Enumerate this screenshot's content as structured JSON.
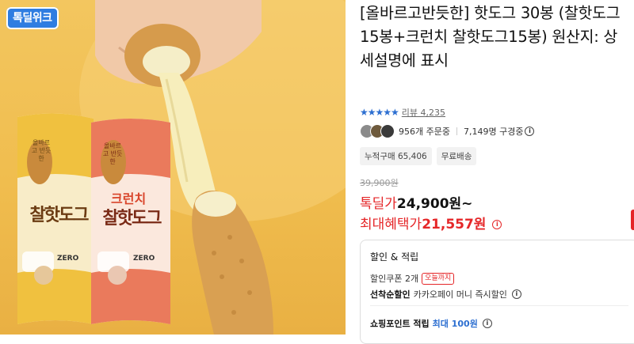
{
  "hero": {
    "logo_text": "톡딜위크",
    "pack_left": {
      "badge": "올바르고 반듯한",
      "name": "찰핫도그",
      "tag": "ZERO"
    },
    "pack_right": {
      "badge": "올바르고 반듯한",
      "top": "크런치",
      "name": "찰핫도그",
      "tag": "ZERO"
    }
  },
  "title": "[올바르고반듯한] 핫도그 30봉 (찰핫도그 15봉+크런치 찰핫도그15봉) 원산지: 상세설명에 표시",
  "rating": {
    "stars": "★★★★★",
    "rating_fraction": 0.95,
    "review_label": "리뷰 4,235"
  },
  "stats": {
    "orders": "956개 주문중",
    "watchers": "7,149명 구경중"
  },
  "chips": [
    "누적구매 65,406",
    "무료배송"
  ],
  "price": {
    "original": "39,900원",
    "deal_label": "톡딜가",
    "deal_value": "24,900원~",
    "max_label": "최대혜택가",
    "max_value": "21,557원"
  },
  "benefits": {
    "title": "할인 & 적립",
    "coupon_text": "할인쿠폰 2개",
    "coupon_badge": "오늘까지",
    "first_label": "선착순할인",
    "first_text": "카카오페이 머니 즉시할인",
    "points_label": "쇼핑포인트 적립",
    "points_value": "최대 100원"
  },
  "colors": {
    "accent_red": "#e52628",
    "accent_blue": "#2d6fd1",
    "logo_blue": "#2f7de1"
  }
}
